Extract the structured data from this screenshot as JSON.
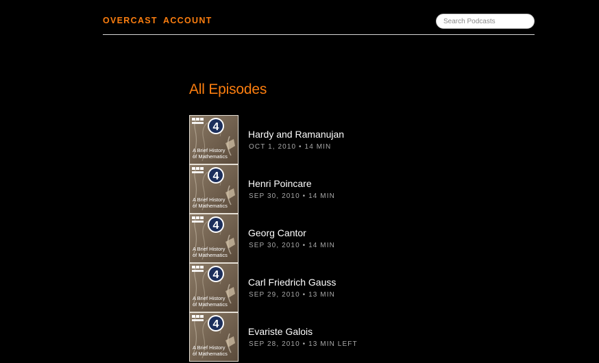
{
  "nav": {
    "overcast_label": "OVERCAST",
    "account_label": "ACCOUNT",
    "search_placeholder": "Search Podcasts"
  },
  "page": {
    "title": "All Episodes"
  },
  "artwork": {
    "station": "BBC RADIO",
    "channel": "4",
    "show": "A Brief History of Mathematics"
  },
  "episodes": [
    {
      "title": "Hardy and Ramanujan",
      "meta": "OCT 1, 2010 • 14 MIN"
    },
    {
      "title": "Henri Poincare",
      "meta": "SEP 30, 2010 • 14 MIN"
    },
    {
      "title": "Georg Cantor",
      "meta": "SEP 30, 2010 • 14 MIN"
    },
    {
      "title": "Carl Friedrich Gauss",
      "meta": "SEP 29, 2010 • 13 MIN"
    },
    {
      "title": "Evariste Galois",
      "meta": "SEP 28, 2010 • 13 MIN LEFT"
    }
  ],
  "colors": {
    "accent": "#fc7e0f",
    "background": "#000000",
    "text": "#ffffff",
    "muted": "#a8a8a8"
  }
}
